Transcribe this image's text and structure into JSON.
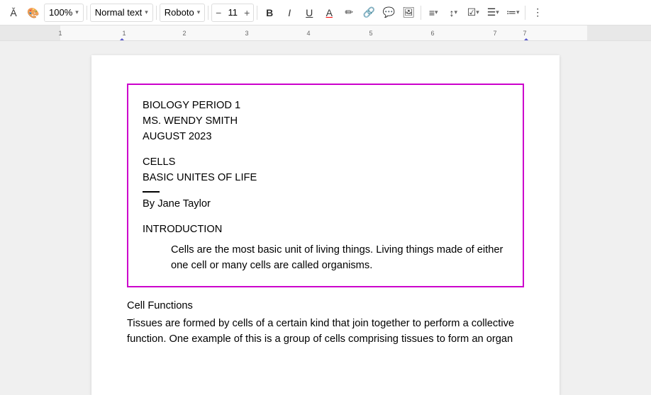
{
  "toolbar": {
    "zoom": "100%",
    "text_style": "Normal text",
    "font": "Roboto",
    "font_size": "11",
    "bold_label": "B",
    "italic_label": "I",
    "underline_label": "U",
    "font_color_label": "A",
    "highlight_label": "✏",
    "link_label": "🔗",
    "comment_label": "💬",
    "image_label": "🖼",
    "align_label": "≡",
    "spacing_label": "↕",
    "format_label": "⊞",
    "bullets_label": "☰",
    "more_label": "⋯"
  },
  "document": {
    "selected_block": {
      "line1": "BIOLOGY PERIOD 1",
      "line2": "MS. WENDY SMITH",
      "line3": "AUGUST 2023",
      "title1": "CELLS",
      "title2": "BASIC UNITES OF LIFE",
      "author_prefix": "By ",
      "author_name": "Jane Taylor",
      "section_title": "INTRODUCTION",
      "intro_para": "Cells are the most basic unit of living things. Living things made of either one cell or many cells are called organisms."
    },
    "below_block": {
      "subheading": "Cell Functions",
      "para": "Tissues are formed by cells of a certain kind that join together to perform a collective function. One example of this is a group of cells comprising tissues to form an organ"
    }
  }
}
